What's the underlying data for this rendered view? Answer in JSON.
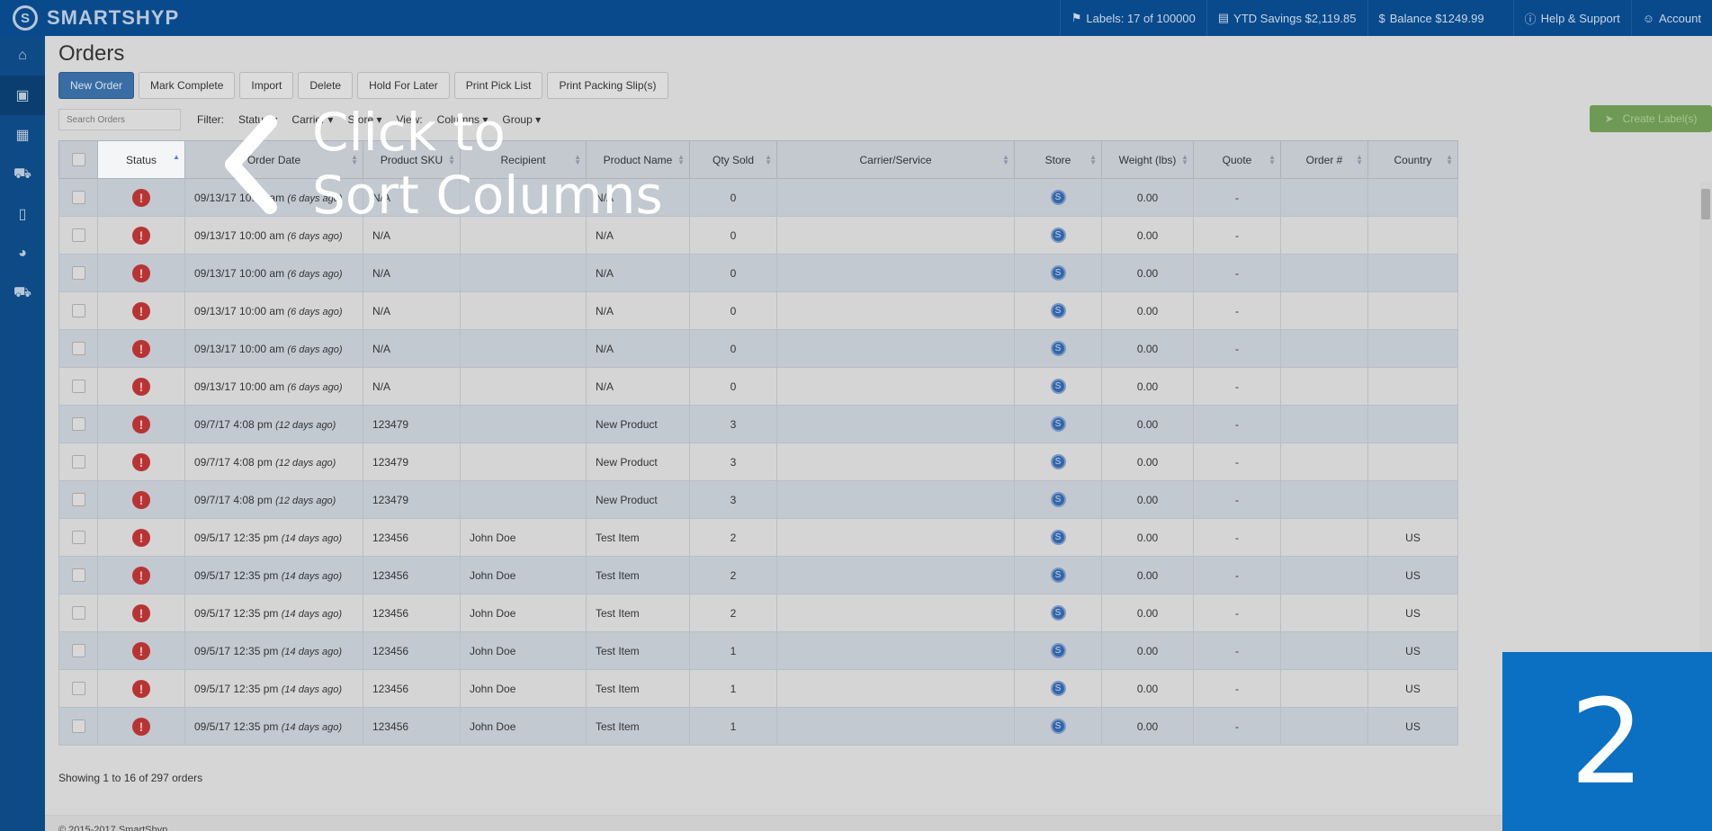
{
  "brand": {
    "logo_letter": "S",
    "name": "SMARTSHYP"
  },
  "topbar": {
    "labels": "Labels: 17 of 100000",
    "ytd_savings": "YTD Savings $2,119.85",
    "balance": "Balance $1249.99",
    "help": "Help & Support",
    "account": "Account"
  },
  "sidebar": {
    "items": [
      {
        "icon": "home-icon"
      },
      {
        "icon": "basket-icon"
      },
      {
        "icon": "calendar-icon"
      },
      {
        "icon": "truck-icon"
      },
      {
        "icon": "contacts-icon"
      },
      {
        "icon": "pie-chart-icon"
      },
      {
        "icon": "cart-icon"
      }
    ]
  },
  "page": {
    "title": "Orders"
  },
  "toolbar": {
    "new_order": "New Order",
    "mark_complete": "Mark Complete",
    "import": "Import",
    "delete": "Delete",
    "hold_for_later": "Hold For Later",
    "print_pick_list": "Print Pick List",
    "print_packing_slips": "Print Packing Slip(s)"
  },
  "filters": {
    "search_placeholder": "Search Orders",
    "filter_label": "Filter:",
    "status": "Status",
    "carrier": "Carrier",
    "store": "Store",
    "view": "View:",
    "columns": "Columns",
    "group": "Group"
  },
  "create_label": "Create Label(s)",
  "table": {
    "columns": [
      "Status",
      "Order Date",
      "Product SKU",
      "Recipient",
      "Product Name",
      "Qty Sold",
      "Carrier/Service",
      "Store",
      "Weight (lbs)",
      "Quote",
      "Order #",
      "Country"
    ],
    "rows": [
      {
        "date": "09/13/17 10:00 am",
        "ago": "(6 days ago)",
        "sku": "N/A",
        "recipient": "",
        "product": "N/A",
        "qty": "0",
        "carrier": "",
        "weight": "0.00",
        "quote": "-",
        "order": "",
        "country": ""
      },
      {
        "date": "09/13/17 10:00 am",
        "ago": "(6 days ago)",
        "sku": "N/A",
        "recipient": "",
        "product": "N/A",
        "qty": "0",
        "carrier": "",
        "weight": "0.00",
        "quote": "-",
        "order": "",
        "country": ""
      },
      {
        "date": "09/13/17 10:00 am",
        "ago": "(6 days ago)",
        "sku": "N/A",
        "recipient": "",
        "product": "N/A",
        "qty": "0",
        "carrier": "",
        "weight": "0.00",
        "quote": "-",
        "order": "",
        "country": ""
      },
      {
        "date": "09/13/17 10:00 am",
        "ago": "(6 days ago)",
        "sku": "N/A",
        "recipient": "",
        "product": "N/A",
        "qty": "0",
        "carrier": "",
        "weight": "0.00",
        "quote": "-",
        "order": "",
        "country": ""
      },
      {
        "date": "09/13/17 10:00 am",
        "ago": "(6 days ago)",
        "sku": "N/A",
        "recipient": "",
        "product": "N/A",
        "qty": "0",
        "carrier": "",
        "weight": "0.00",
        "quote": "-",
        "order": "",
        "country": ""
      },
      {
        "date": "09/13/17 10:00 am",
        "ago": "(6 days ago)",
        "sku": "N/A",
        "recipient": "",
        "product": "N/A",
        "qty": "0",
        "carrier": "",
        "weight": "0.00",
        "quote": "-",
        "order": "",
        "country": ""
      },
      {
        "date": "09/7/17 4:08 pm",
        "ago": "(12 days ago)",
        "sku": "123479",
        "recipient": "",
        "product": "New Product",
        "qty": "3",
        "carrier": "",
        "weight": "0.00",
        "quote": "-",
        "order": "",
        "country": ""
      },
      {
        "date": "09/7/17 4:08 pm",
        "ago": "(12 days ago)",
        "sku": "123479",
        "recipient": "",
        "product": "New Product",
        "qty": "3",
        "carrier": "",
        "weight": "0.00",
        "quote": "-",
        "order": "",
        "country": ""
      },
      {
        "date": "09/7/17 4:08 pm",
        "ago": "(12 days ago)",
        "sku": "123479",
        "recipient": "",
        "product": "New Product",
        "qty": "3",
        "carrier": "",
        "weight": "0.00",
        "quote": "-",
        "order": "",
        "country": ""
      },
      {
        "date": "09/5/17 12:35 pm",
        "ago": "(14 days ago)",
        "sku": "123456",
        "recipient": "John Doe",
        "product": "Test Item",
        "qty": "2",
        "carrier": "",
        "weight": "0.00",
        "quote": "-",
        "order": "",
        "country": "US"
      },
      {
        "date": "09/5/17 12:35 pm",
        "ago": "(14 days ago)",
        "sku": "123456",
        "recipient": "John Doe",
        "product": "Test Item",
        "qty": "2",
        "carrier": "",
        "weight": "0.00",
        "quote": "-",
        "order": "",
        "country": "US"
      },
      {
        "date": "09/5/17 12:35 pm",
        "ago": "(14 days ago)",
        "sku": "123456",
        "recipient": "John Doe",
        "product": "Test Item",
        "qty": "2",
        "carrier": "",
        "weight": "0.00",
        "quote": "-",
        "order": "",
        "country": "US"
      },
      {
        "date": "09/5/17 12:35 pm",
        "ago": "(14 days ago)",
        "sku": "123456",
        "recipient": "John Doe",
        "product": "Test Item",
        "qty": "1",
        "carrier": "",
        "weight": "0.00",
        "quote": "-",
        "order": "",
        "country": "US"
      },
      {
        "date": "09/5/17 12:35 pm",
        "ago": "(14 days ago)",
        "sku": "123456",
        "recipient": "John Doe",
        "product": "Test Item",
        "qty": "1",
        "carrier": "",
        "weight": "0.00",
        "quote": "-",
        "order": "",
        "country": "US"
      },
      {
        "date": "09/5/17 12:35 pm",
        "ago": "(14 days ago)",
        "sku": "123456",
        "recipient": "John Doe",
        "product": "Test Item",
        "qty": "1",
        "carrier": "",
        "weight": "0.00",
        "quote": "-",
        "order": "",
        "country": "US"
      }
    ]
  },
  "showing": "Showing 1 to 16 of 297 orders",
  "footer": "© 2015-2017 SmartShyp",
  "overlay": {
    "line1": "Click to",
    "line2": "Sort Columns",
    "step": "2"
  }
}
